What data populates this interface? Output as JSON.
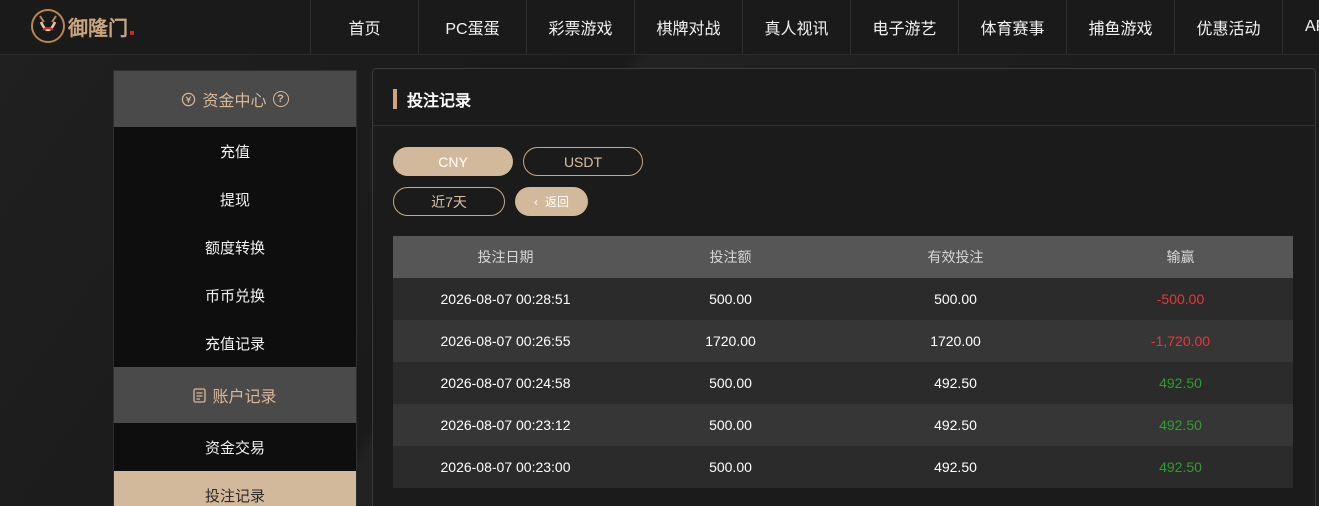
{
  "header": {
    "logo_text": "御隆门",
    "nav": [
      "首页",
      "PC蛋蛋",
      "彩票游戏",
      "棋牌对战",
      "真人视讯",
      "电子游艺",
      "体育赛事",
      "捕鱼游戏",
      "优惠活动",
      "APP"
    ]
  },
  "sidebar": {
    "funds_center": "资金中心",
    "help_glyph": "?",
    "funds_items": [
      "充值",
      "提现",
      "额度转换",
      "币币兑换",
      "充值记录"
    ],
    "account_records": "账户记录",
    "account_items": [
      "资金交易",
      "投注记录"
    ],
    "active_item": "投注记录"
  },
  "main": {
    "title": "投注记录",
    "currency_tabs": [
      "CNY",
      "USDT"
    ],
    "selected_currency": "CNY",
    "period_button": "近7天",
    "back_button": "返回",
    "back_icon": "chevron-left-icon",
    "table": {
      "headers": [
        "投注日期",
        "投注额",
        "有效投注",
        "输赢"
      ],
      "rows": [
        {
          "date": "2026-08-07 00:28:51",
          "amount": "500.00",
          "valid": "500.00",
          "win": "-500.00",
          "win_status": "neg"
        },
        {
          "date": "2026-08-07 00:26:55",
          "amount": "1720.00",
          "valid": "1720.00",
          "win": "-1,720.00",
          "win_status": "neg"
        },
        {
          "date": "2026-08-07 00:24:58",
          "amount": "500.00",
          "valid": "492.50",
          "win": "492.50",
          "win_status": "pos"
        },
        {
          "date": "2026-08-07 00:23:12",
          "amount": "500.00",
          "valid": "492.50",
          "win": "492.50",
          "win_status": "pos"
        },
        {
          "date": "2026-08-07 00:23:00",
          "amount": "500.00",
          "valid": "492.50",
          "win": "492.50",
          "win_status": "pos"
        }
      ]
    }
  },
  "colors": {
    "accent": "#d3b99c",
    "negative": "#e53935",
    "positive": "#2e9e2e"
  }
}
